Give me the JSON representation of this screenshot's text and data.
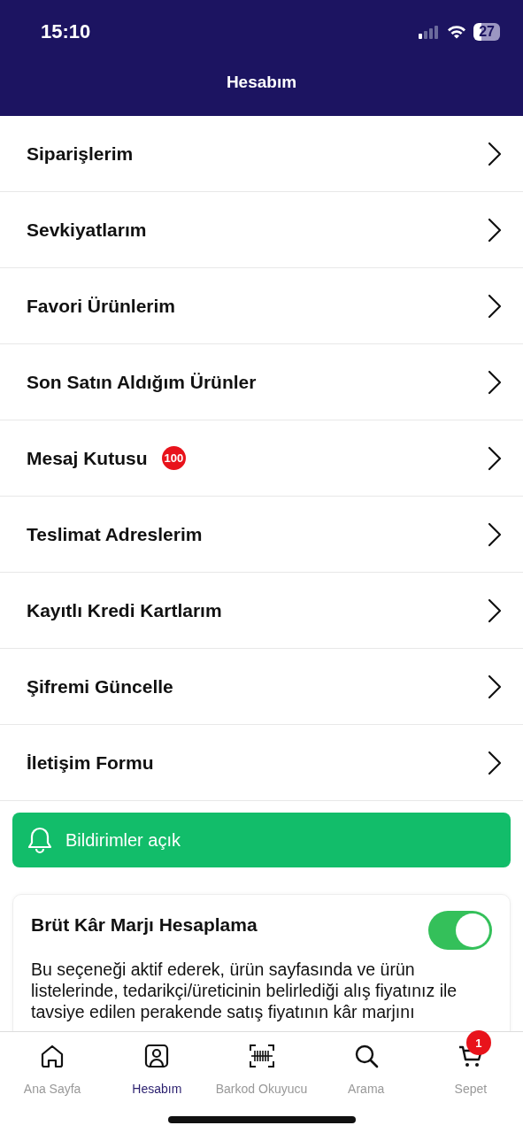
{
  "status_bar": {
    "time": "15:10",
    "battery": "27"
  },
  "header": {
    "title": "Hesabım"
  },
  "menu": [
    {
      "label": "Siparişlerim"
    },
    {
      "label": "Sevkiyatlarım"
    },
    {
      "label": "Favori Ürünlerim"
    },
    {
      "label": "Son Satın Aldığım Ürünler"
    },
    {
      "label": "Mesaj Kutusu",
      "badge": "100"
    },
    {
      "label": "Teslimat Adreslerim"
    },
    {
      "label": "Kayıtlı Kredi Kartlarım"
    },
    {
      "label": "Şifremi Güncelle"
    },
    {
      "label": "İletişim Formu"
    }
  ],
  "notifications": {
    "label": "Bildirimler açık",
    "on": true
  },
  "margin_card": {
    "title": "Brüt Kâr Marjı Hesaplama",
    "on": true,
    "description": "Bu seçeneği aktif ederek, ürün sayfasında ve ürün listelerinde, tedarikçi/üreticinin belirlediği alış fiyatınız ile tavsiye edilen perakende satış fiyatının kâr marjını"
  },
  "tab_bar": [
    {
      "kind": "home",
      "label": "Ana Sayfa",
      "selected": false
    },
    {
      "kind": "account",
      "label": "Hesabım",
      "selected": true
    },
    {
      "kind": "barcode",
      "label": "Barkod Okuyucu",
      "selected": false
    },
    {
      "kind": "search",
      "label": "Arama",
      "selected": false
    },
    {
      "kind": "cart",
      "label": "Sepet",
      "selected": false,
      "badge": "1"
    }
  ]
}
